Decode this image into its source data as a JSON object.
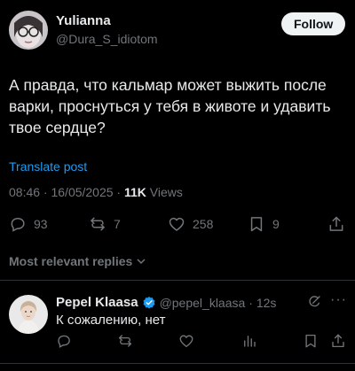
{
  "tweet": {
    "author_name": "Yulianna",
    "author_handle": "@Dura_S_idiotom",
    "follow_label": "Follow",
    "text": "А правда, что кальмар может выжить после варки, проснуться у тебя в животе и удавить твое сердце?",
    "translate_label": "Translate post",
    "timestamp": "08:46 · 16/05/2025 · ",
    "views_count": "11K",
    "views_label": " Views",
    "actions": {
      "replies": "93",
      "reposts": "7",
      "likes": "258",
      "bookmarks": "9"
    }
  },
  "replies_filter_label": "Most relevant replies",
  "reply": {
    "author_name": "Pepel Klaasa",
    "author_handle": "@pepel_klaasa",
    "time": "· 12s",
    "text": "К сожалению, нет",
    "more_label": "···"
  },
  "colors": {
    "accent": "#1d9bf0",
    "muted": "#71767b",
    "text": "#e7e9ea",
    "background": "#000000"
  }
}
